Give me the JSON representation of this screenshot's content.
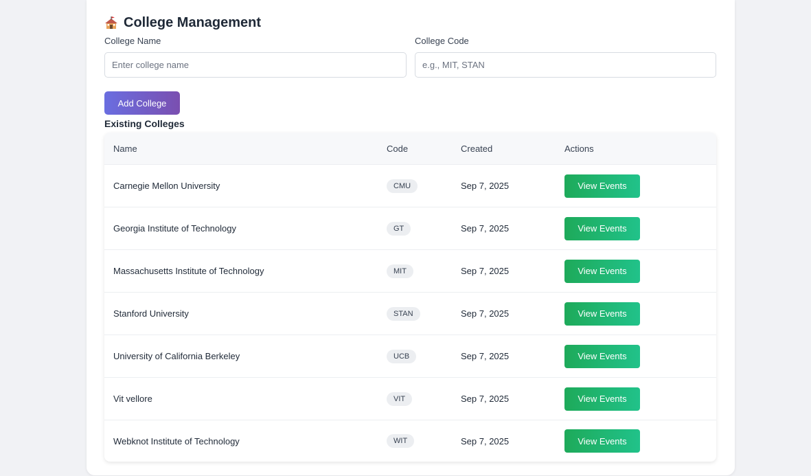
{
  "page": {
    "title": "College Management",
    "title_icon": "school-icon"
  },
  "form": {
    "name_label": "College Name",
    "name_placeholder": "Enter college name",
    "name_value": "",
    "code_label": "College Code",
    "code_placeholder": "e.g., MIT, STAN",
    "code_value": "",
    "add_button": "Add College"
  },
  "colors": {
    "add_button_gradient": [
      "#6a6ee0",
      "#7a4fb0"
    ],
    "view_button_gradient": [
      "#1eaa5a",
      "#21c28a"
    ],
    "badge_bg": "#eceef1"
  },
  "table": {
    "title": "Existing Colleges",
    "headers": [
      "Name",
      "Code",
      "Created",
      "Actions"
    ],
    "rows": [
      {
        "name": "Carnegie Mellon University",
        "code": "CMU",
        "created": "Sep 7, 2025",
        "action": "View Events"
      },
      {
        "name": "Georgia Institute of Technology",
        "code": "GT",
        "created": "Sep 7, 2025",
        "action": "View Events"
      },
      {
        "name": "Massachusetts Institute of Technology",
        "code": "MIT",
        "created": "Sep 7, 2025",
        "action": "View Events"
      },
      {
        "name": "Stanford University",
        "code": "STAN",
        "created": "Sep 7, 2025",
        "action": "View Events"
      },
      {
        "name": "University of California Berkeley",
        "code": "UCB",
        "created": "Sep 7, 2025",
        "action": "View Events"
      },
      {
        "name": "Vit vellore",
        "code": "VIT",
        "created": "Sep 7, 2025",
        "action": "View Events"
      },
      {
        "name": "Webknot Institute of Technology",
        "code": "WIT",
        "created": "Sep 7, 2025",
        "action": "View Events"
      }
    ]
  }
}
